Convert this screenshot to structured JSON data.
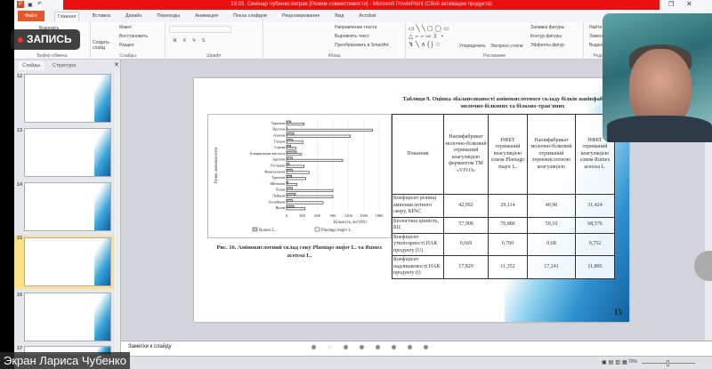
{
  "window": {
    "title": "19.03. Семінар Чубенко виграв [Режим совместимости] - Microsoft PowerPoint (Сбой активации продукта)"
  },
  "tabs": [
    "Файл",
    "Главная",
    "Вставка",
    "Дизайн",
    "Переходы",
    "Анимация",
    "Показ слайдов",
    "Рецензирование",
    "Вид",
    "Acrobat"
  ],
  "ribbon": {
    "clipboard": {
      "label": "Буфер обмена",
      "cut": "Вырезать"
    },
    "slides": {
      "label": "Слайды",
      "new_slide": "Создать слайд",
      "layout": "Макет",
      "reset": "Восстановить",
      "section": "Раздел"
    },
    "font": {
      "label": "Шрифт"
    },
    "paragraph": {
      "label": "Абзац",
      "text_direction": "Направление текста",
      "align_text": "Выровнять текст",
      "smartart": "Преобразовать в SmartArt"
    },
    "drawing": {
      "label": "Рисование",
      "arrange": "Упорядочить",
      "quick_styles": "Экспресс-стили",
      "fill": "Заливка фигуры",
      "outline": "Контур фигуры",
      "effects": "Эффекты фигур"
    },
    "editing": {
      "label": "Редактирование",
      "find": "Найти",
      "replace": "Заменить",
      "select": "Выделить"
    }
  },
  "panel": {
    "tabs": [
      "Слайды",
      "Структура"
    ],
    "slides": [
      "12",
      "13",
      "14",
      "15",
      "16",
      "17"
    ],
    "selected": "15"
  },
  "slide": {
    "page_number": "15",
    "caption_prefix": "Рис. 16. Амінокислотний склад соку ",
    "caption_italic1": "Plantago major",
    "caption_mid": " L. та ",
    "caption_italic2": "Rumex acetosa",
    "caption_end": " L.",
    "table_title": "Таблиця 9. Оцінка збалансованості амінокислотного складу білків напівфабрикатів молочно-білкових та білково-трав'яних",
    "table": {
      "headers": [
        "Показник",
        "Напівфабрикат молочно-білковий отриманий коагуляцією ферментом ТМ «VIVO»",
        "НФБТ отриманий коагуляцією соком Plantago major L.",
        "Напівфабрикат молочно-білковий отриманий термокислотною коагуляцією",
        "НФБТ отриманий коагуляцією соком Rumex acetosa L."
      ],
      "rows": [
        [
          "Коефіцієнт різниці амінокислотного скору, КРАС",
          "42,092",
          "29,114",
          "40,90",
          "31,424"
        ],
        [
          "Біологічна цінність, БЦ",
          "57,908",
          "70,886",
          "59,10",
          "68,576"
        ],
        [
          "Коефіцієнт утилітарності НАК продукту (U)",
          "0,669",
          "0,760",
          "0,68",
          "0,752"
        ],
        [
          "Коефіцієнт надлишковості НАК продукту (t)",
          "17,829",
          "11,352",
          "17,241",
          "11,895"
        ]
      ]
    }
  },
  "chart_data": {
    "type": "bar",
    "orientation": "horizontal",
    "categories": [
      "Тирозин",
      "Цистин",
      "Аланін",
      "Гліцин",
      "Серин",
      "Аспарагінова кислота",
      "Аргінін",
      "Гістидин",
      "Фенілаланін",
      "Треонін",
      "Метіонін",
      "Лізин",
      "Лейцин",
      "Ізолейцин",
      "Валін"
    ],
    "series": [
      {
        "name": "Rumex L.",
        "values": [
          80,
          5,
          140,
          110,
          80,
          190,
          110,
          50,
          110,
          100,
          30,
          110,
          170,
          110,
          140
        ]
      },
      {
        "name": "Plantago major L.",
        "values": [
          340,
          1670,
          1240,
          320,
          180,
          280,
          1090,
          340,
          440,
          370,
          200,
          900,
          900,
          710,
          360
        ]
      }
    ],
    "xlabel": "Кількість, мг/100 г",
    "ylabel": "Назва амінокислоти",
    "xticks": [
      "0",
      "300",
      "600",
      "900",
      "1200",
      "1500",
      "1800"
    ],
    "xlim": [
      0,
      1800
    ],
    "grid": true,
    "legend": "bottom"
  },
  "notes": {
    "placeholder": "Заметки к слайду"
  },
  "status": {
    "zoom": "70%"
  },
  "overlay": {
    "recording": "ЗАПИСЬ",
    "screen_owner": "Экран Лариса Чубенко"
  }
}
